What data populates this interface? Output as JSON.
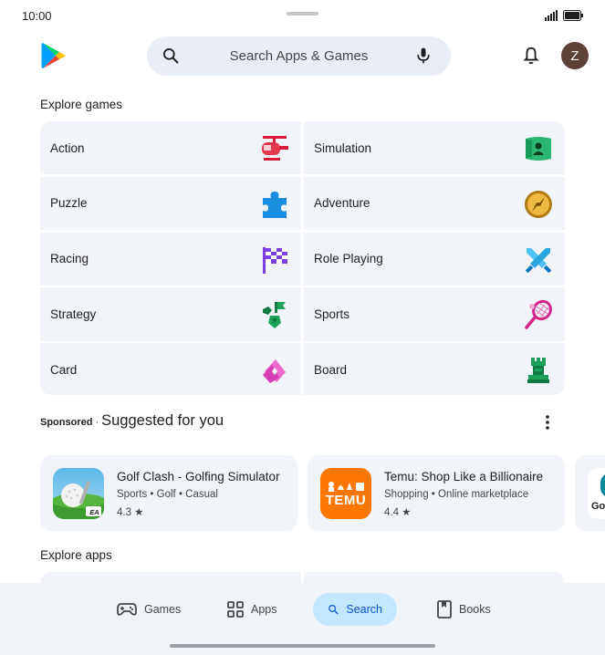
{
  "status_bar": {
    "time": "10:00"
  },
  "search": {
    "placeholder": "Search Apps & Games"
  },
  "account": {
    "initial": "Z"
  },
  "explore_games": {
    "title": "Explore games",
    "categories": [
      {
        "label": "Action",
        "icon": "helicopter-icon"
      },
      {
        "label": "Simulation",
        "icon": "simulation-icon"
      },
      {
        "label": "Puzzle",
        "icon": "puzzle-piece-icon"
      },
      {
        "label": "Adventure",
        "icon": "compass-icon"
      },
      {
        "label": "Racing",
        "icon": "checkered-flag-icon"
      },
      {
        "label": "Role Playing",
        "icon": "crossed-swords-icon"
      },
      {
        "label": "Strategy",
        "icon": "strategy-icon"
      },
      {
        "label": "Sports",
        "icon": "tennis-racket-icon"
      },
      {
        "label": "Card",
        "icon": "cards-icon"
      },
      {
        "label": "Board",
        "icon": "chess-piece-icon"
      }
    ]
  },
  "suggested": {
    "sponsored_label": "Sponsored",
    "separator": "·",
    "title": "Suggested for you",
    "apps": [
      {
        "name": "Golf Clash - Golfing Simulator",
        "tags": [
          "Sports",
          "Golf",
          "Casual"
        ],
        "tags_text": "Sports • Golf • Casual",
        "rating": "4.3 ★",
        "icon_badge": "EA"
      },
      {
        "name": "Temu: Shop Like a Billionaire",
        "tags": [
          "Shopping",
          "Online marketplace"
        ],
        "tags_text": "Shopping • Online marketplace",
        "rating": "4.4 ★",
        "icon_text": "TEMU"
      },
      {
        "name": "Go",
        "partial": true
      }
    ]
  },
  "explore_apps": {
    "title": "Explore apps"
  },
  "bottom_nav": {
    "active": "Search",
    "items": [
      {
        "label": "Games",
        "icon": "gamepad-icon"
      },
      {
        "label": "Apps",
        "icon": "apps-grid-icon"
      },
      {
        "label": "Search",
        "icon": "search-icon"
      },
      {
        "label": "Books",
        "icon": "book-icon"
      }
    ]
  },
  "colors": {
    "accent": "#0b57d0",
    "active_nav_bg": "#c2e7ff",
    "tile_bg": "#f1f4f9",
    "search_bg": "#e9eef6",
    "temu_orange": "#fb7701",
    "avatar_bg": "#5d4037"
  }
}
